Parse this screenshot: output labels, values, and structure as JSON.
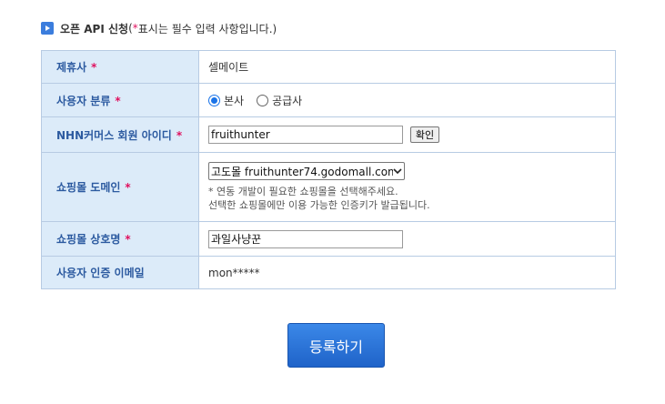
{
  "section": {
    "title": "오픈 API 신청",
    "note_open": "(",
    "note_star": "*",
    "note_text": " 표시는 필수 입력 사항입니다.)"
  },
  "form": {
    "rows": [
      {
        "label": "제휴사",
        "required": "*",
        "value": "셀메이트"
      },
      {
        "label": "사용자 분류",
        "required": "*",
        "options": [
          "본사",
          "공급사"
        ],
        "selected": "본사"
      },
      {
        "label": "NHN커머스 회원 아이디",
        "required": "*",
        "value": "fruithunter",
        "button": "확인"
      },
      {
        "label": "쇼핑몰 도메인",
        "required": "*",
        "select_value": "고도몰 fruithunter74.godomall.com",
        "help_1": "* 연동 개발이 필요한 쇼핑몰을 선택해주세요.",
        "help_2": "선택한 쇼핑몰에만 이용 가능한 인증키가 발급됩니다."
      },
      {
        "label": "쇼핑몰 상호명",
        "required": "*",
        "value": "과일사냥꾼"
      },
      {
        "label": "사용자 인증 이메일",
        "value": "mon*****"
      }
    ]
  },
  "submit_label": "등록하기",
  "colors": {
    "label_bg": "#dcebf9",
    "label_text": "#2c5aa0",
    "required": "#e0115f",
    "button": "#2b74d9"
  }
}
